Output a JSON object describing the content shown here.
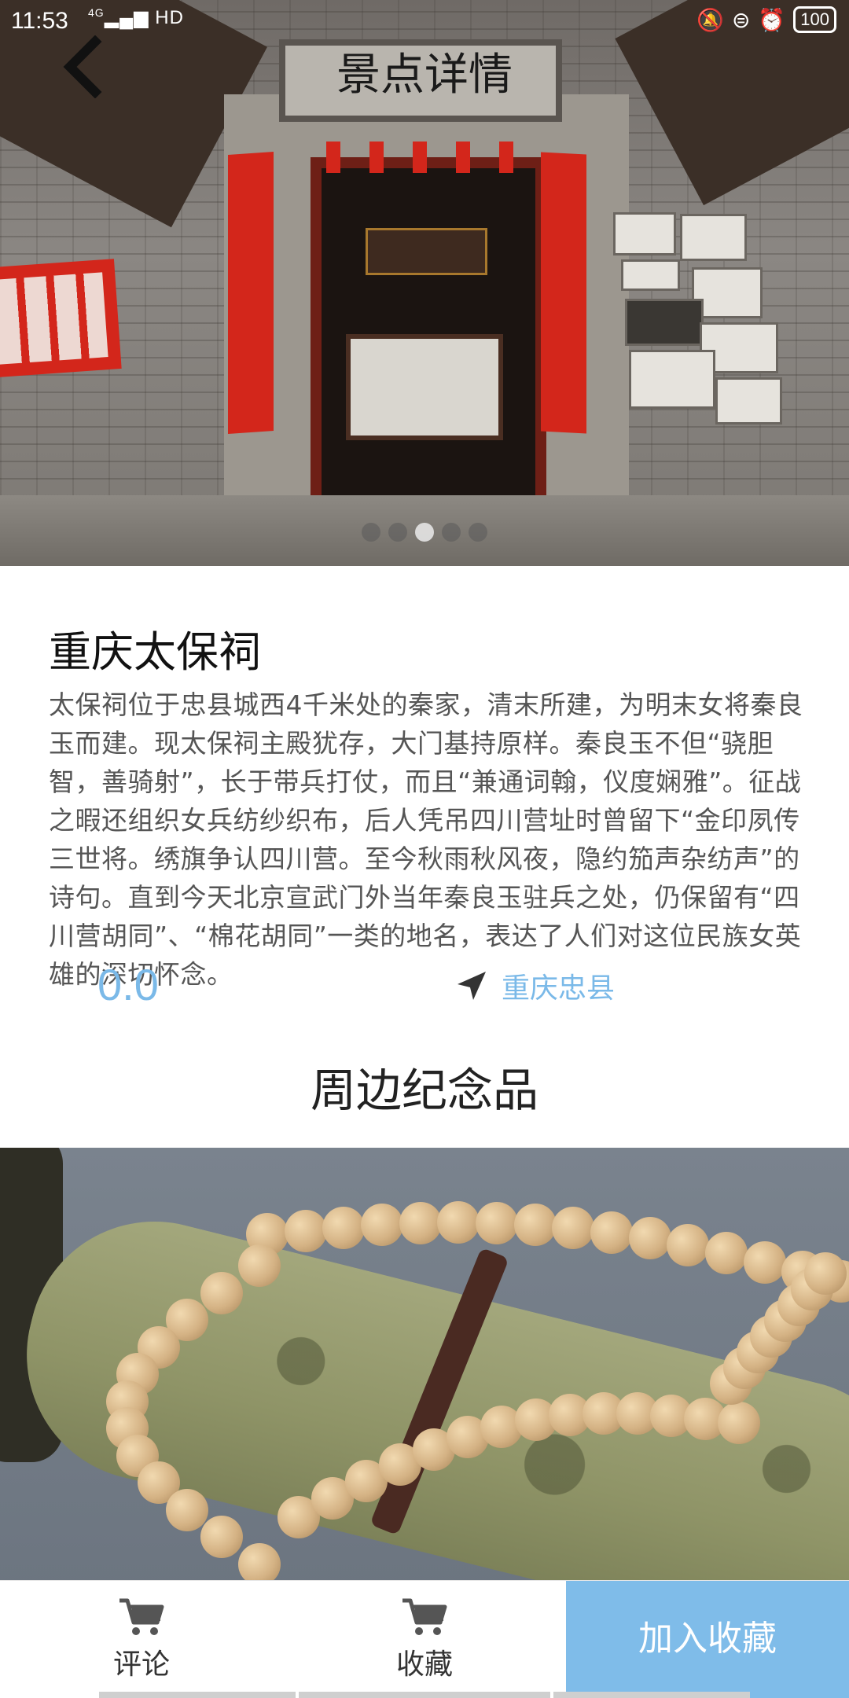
{
  "status_bar": {
    "time": "11:53",
    "network": "4G",
    "hd": "HD",
    "battery": "100"
  },
  "header": {
    "title": "景点详情"
  },
  "carousel": {
    "count": 5,
    "active_index": 2
  },
  "spot": {
    "name": "重庆太保祠",
    "description": "太保祠位于忠县城西4千米处的秦家，清末所建，为明末女将秦良玉而建。现太保祠主殿犹存，大门基持原样。秦良玉不但“骁胆智，善骑射”，长于带兵打仗，而且“兼通词翰，仪度娴雅”。征战之暇还组织女兵纺纱织布，后人凭吊四川营址时曾留下“金印夙传三世将。绣旗争认四川营。至今秋雨秋风夜，隐约笳声杂纺声”的诗句。直到今天北京宣武门外当年秦良玉驻兵之处，仍保留有“四川营胡同”、“棉花胡同”一类的地名，表达了人们对这位民族女英雄的深切怀念。",
    "rating": "0.0",
    "location": "重庆忠县"
  },
  "souvenirs": {
    "section_title": "周边纪念品"
  },
  "bottom_bar": {
    "comment_label": "评论",
    "collect_label": "收藏",
    "add_label": "加入收藏"
  },
  "colors": {
    "accent": "#7fbce9",
    "rating_text": "#7ab9e8"
  },
  "icons": {
    "back": "chevron-left-icon",
    "location": "navigation-arrow-icon",
    "cart": "cart-icon"
  }
}
